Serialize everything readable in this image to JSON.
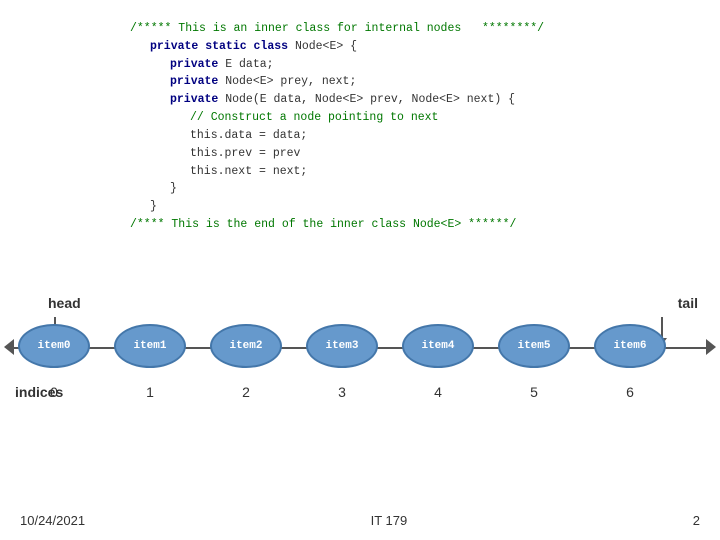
{
  "code": {
    "lines": [
      {
        "indent": 0,
        "type": "comment",
        "text": "/***** This is an inner class for internal nodes  ********/"
      },
      {
        "indent": 1,
        "type": "keyword-line",
        "keyword": "private static class ",
        "rest": "Node<E> {"
      },
      {
        "indent": 2,
        "type": "keyword-line",
        "keyword": "private ",
        "rest": "E data;"
      },
      {
        "indent": 2,
        "type": "keyword-line",
        "keyword": "private ",
        "rest": "Node<E> prey, next;"
      },
      {
        "indent": 2,
        "type": "keyword-line",
        "keyword": "private ",
        "rest": "Node(E data, Node<E> prev, Node<E> next) {"
      },
      {
        "indent": 3,
        "type": "comment",
        "text": "// Construct a node pointing to next"
      },
      {
        "indent": 3,
        "type": "normal",
        "text": "this.data = data;"
      },
      {
        "indent": 3,
        "type": "normal",
        "text": "this.prev = prev"
      },
      {
        "indent": 3,
        "type": "normal",
        "text": "this.next = next;"
      },
      {
        "indent": 2,
        "type": "normal",
        "text": "}"
      },
      {
        "indent": 1,
        "type": "normal",
        "text": "}"
      },
      {
        "indent": 0,
        "type": "comment",
        "text": "/****  This is the end of the inner class Node<E> ******/"
      }
    ]
  },
  "diagram": {
    "head_label": "head",
    "tail_label": "tail",
    "nodes": [
      {
        "label": "item0",
        "index": "0"
      },
      {
        "label": "item1",
        "index": "1"
      },
      {
        "label": "item2",
        "index": "2"
      },
      {
        "label": "item3",
        "index": "3"
      },
      {
        "label": "item4",
        "index": "4"
      },
      {
        "label": "item5",
        "index": "5"
      },
      {
        "label": "item6",
        "index": "6"
      }
    ],
    "indices_label": "indices"
  },
  "footer": {
    "date": "10/24/2021",
    "course": "IT 179",
    "page": "2"
  }
}
